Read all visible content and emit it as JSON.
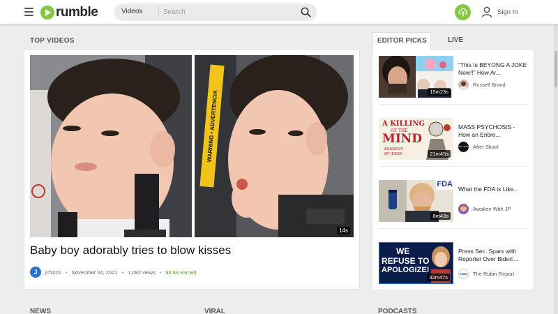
{
  "header": {
    "logo_text": "rumble",
    "search": {
      "category": "Videos",
      "placeholder": "Search"
    },
    "signin_label": "Sign In"
  },
  "top_videos": {
    "section_title": "TOP VIDEOS",
    "featured": {
      "title": "Baby boy adorably tries to blow kisses",
      "duration": "14s",
      "channel_initial": "J",
      "channel": "jrf1021",
      "date": "November 24, 2021",
      "views": "1,092 views",
      "earned": "$3.88 earned",
      "seat_label": "WARNING • ADVERTENCIA"
    }
  },
  "editor_picks": {
    "tabs": [
      {
        "label": "EDITOR PICKS",
        "active": true
      },
      {
        "label": "LIVE",
        "active": false
      }
    ],
    "items": [
      {
        "title": "“This Is BEYONG A JOKE Now!!” How Ar...",
        "duration": "15m23s",
        "channel": "Russell Brand"
      },
      {
        "title": "MASS PSYCHOSIS - How an Entire...",
        "duration": "21m45s",
        "channel": "After Skool",
        "thumb_text": [
          "A KILLING",
          "OF THE",
          "MIND",
          "ACADEMY",
          "OF IDEAS"
        ],
        "avatar_text": "After Skool"
      },
      {
        "title": "What the FDA is Like...",
        "duration": "8m43s",
        "channel": "Awaken With JP",
        "thumb_text": [
          "FDA"
        ]
      },
      {
        "title": "Press Sec. Spars with Reporter Over Biden'...",
        "duration": "32m47s",
        "channel": "The Rubin Report",
        "thumb_text": [
          "WE",
          "REFUSE TO",
          "APOLOGIZE!"
        ],
        "avatar_text": "RUBIN"
      }
    ]
  },
  "bottom_sections": [
    "NEWS",
    "VIRAL",
    "PODCASTS"
  ],
  "colors": {
    "brand_green": "#85c742",
    "earned_green": "#5a9e2f",
    "avatar_blue": "#2e6fd1"
  }
}
